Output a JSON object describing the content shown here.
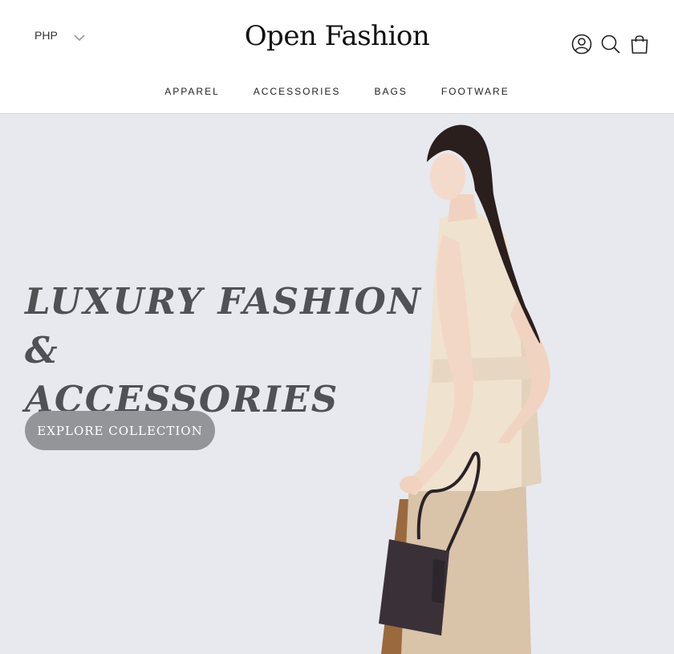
{
  "header": {
    "currency": {
      "label": "PHP",
      "chevron_icon": "chevron-down-icon"
    },
    "logo": "Open Fashion",
    "icons": [
      "account-icon",
      "search-icon",
      "shopping-bag-icon"
    ]
  },
  "nav": {
    "items": [
      {
        "label": "APPAREL"
      },
      {
        "label": "ACCESSORIES"
      },
      {
        "label": "BAGS"
      },
      {
        "label": "FOOTWARE"
      }
    ]
  },
  "hero": {
    "headline_line1": "LUXURY FASHION &",
    "headline_line2": "ACCESSORIES",
    "cta_label": "EXPLORE COLLECTION",
    "background_color": "#e7e9ee",
    "image_subject": "model-with-handbag"
  },
  "colors": {
    "headline": "#4f5155",
    "cta_background": "#949599",
    "cta_text": "#ffffff"
  }
}
